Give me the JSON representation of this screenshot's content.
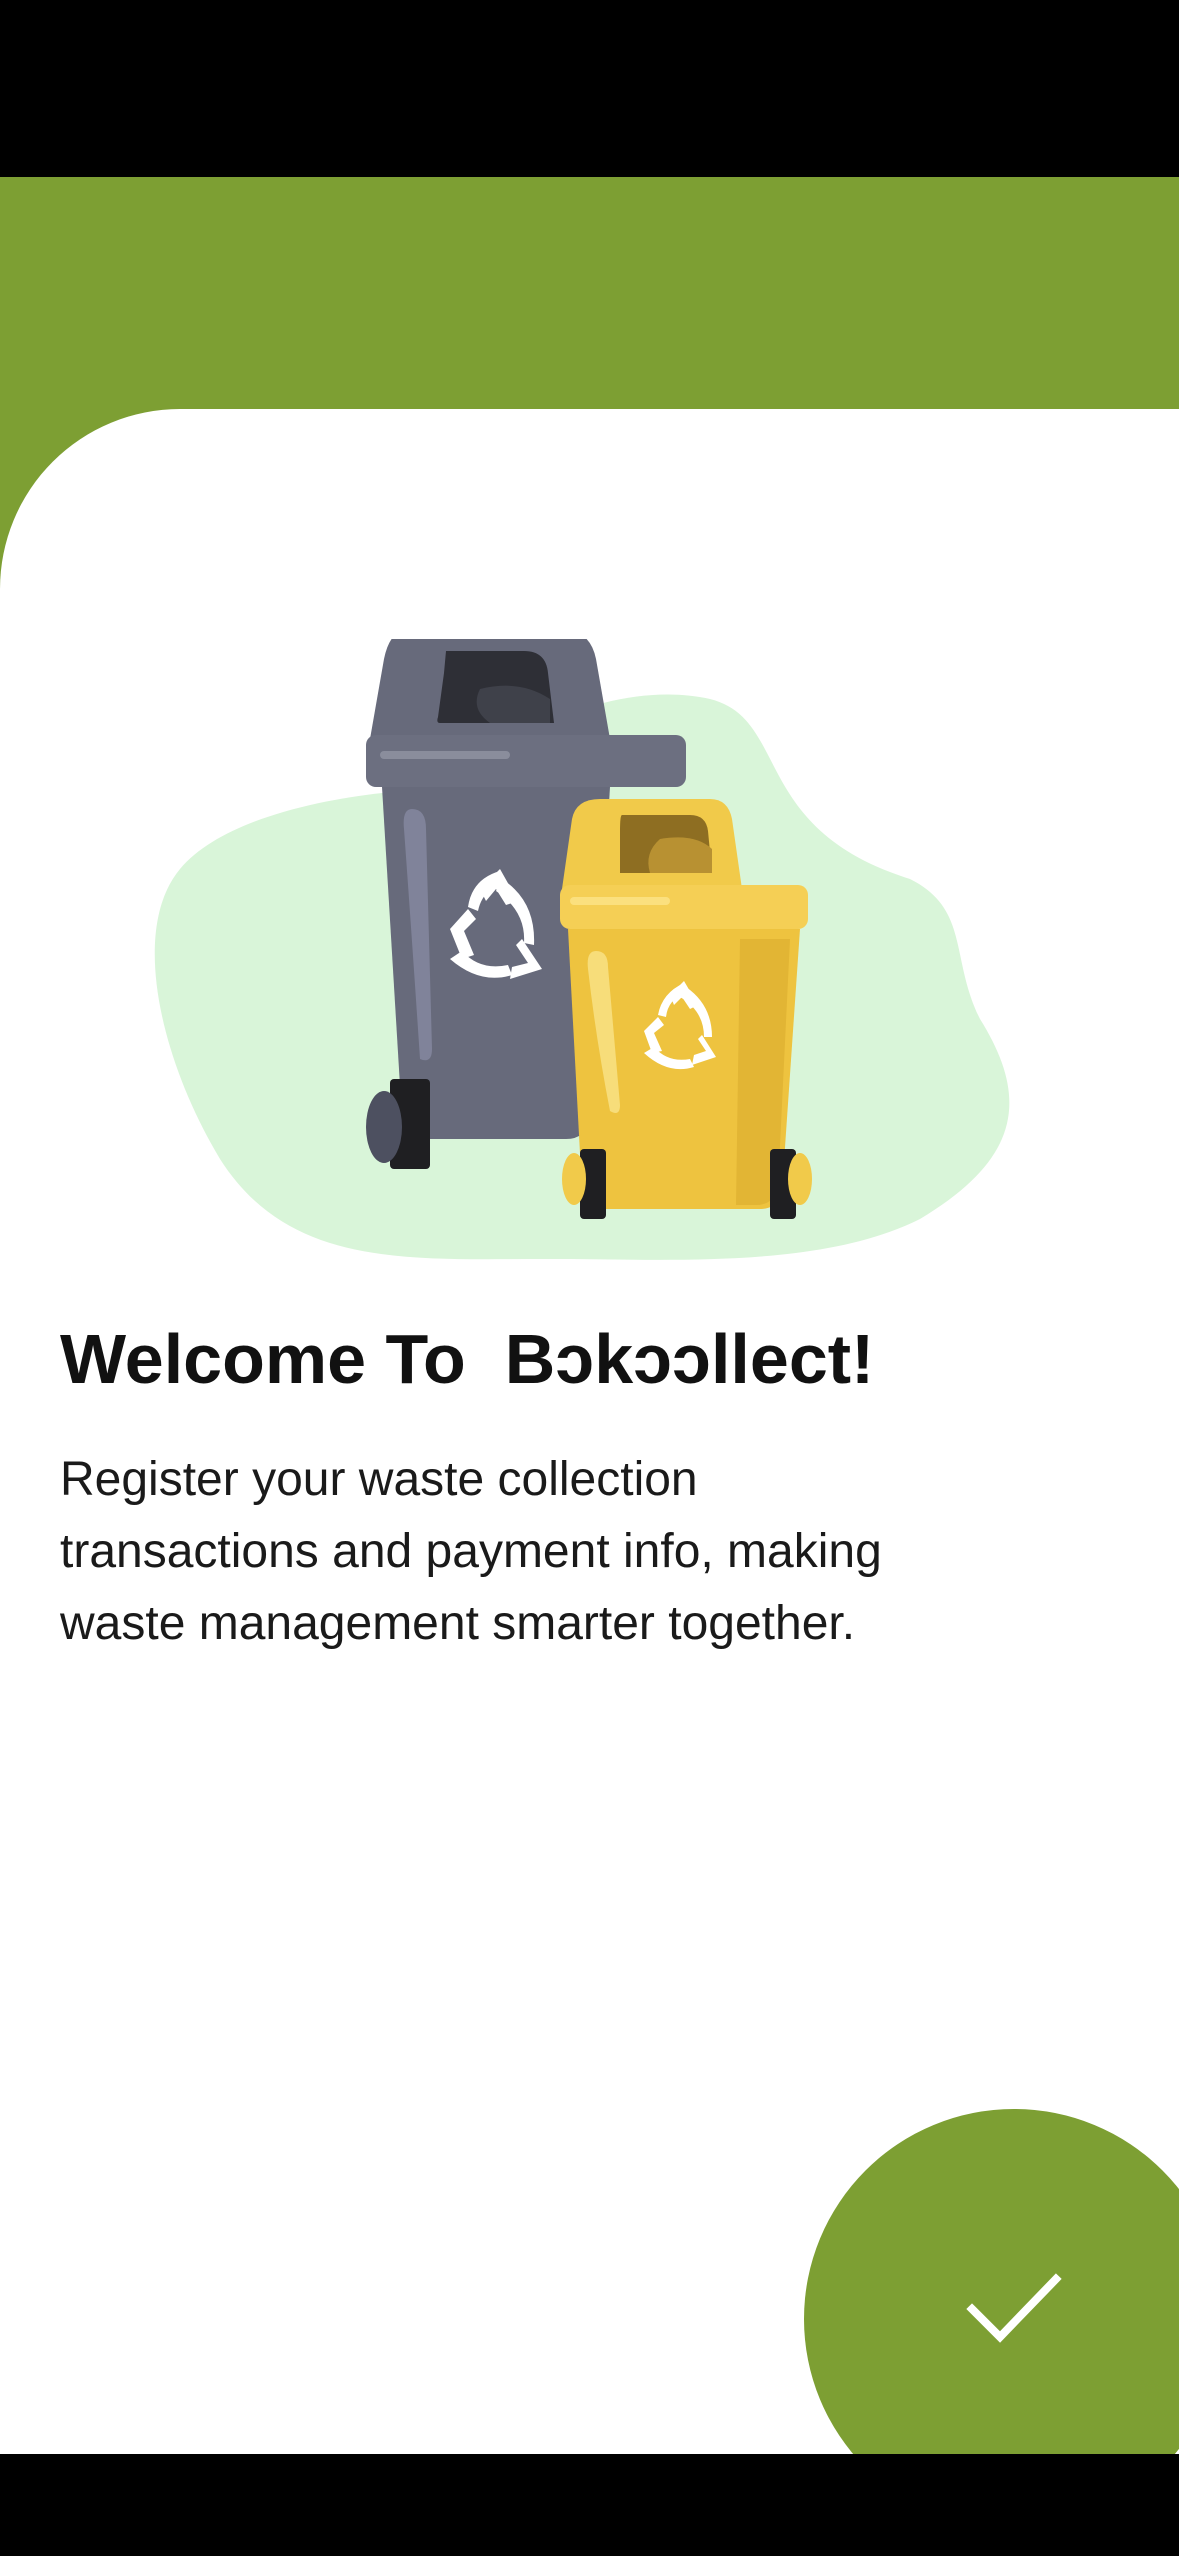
{
  "onboarding": {
    "title": "Welcome To  Bɔkɔɔllect!",
    "description": "Register your waste collection\n transactions and payment info, making\nwaste management smarter together."
  },
  "illustration": {
    "name": "recycling-bins",
    "colors": {
      "blob": "#d9f5d9",
      "gray_bin": "#676a7b",
      "yellow_bin": "#f1ca4a"
    }
  },
  "confirm_button": {
    "icon": "checkmark-icon",
    "color": "#7d9f33"
  },
  "theme": {
    "accent": "#7d9f33",
    "background": "#ffffff"
  }
}
